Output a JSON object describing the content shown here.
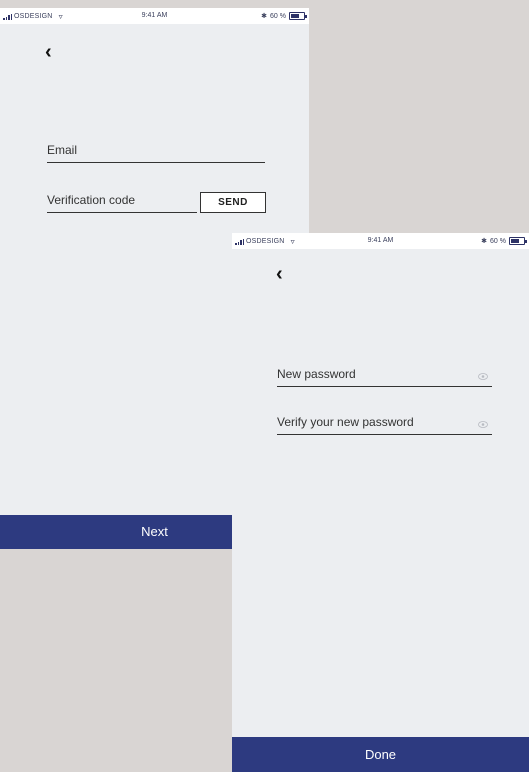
{
  "status_bar": {
    "carrier": "OSDESIGN",
    "time": "9:41 AM",
    "battery": "60 %"
  },
  "screen1": {
    "back_icon": "chevron-left-icon",
    "email_label": "Email",
    "code_label": "Verification code",
    "send_label": "SEND",
    "next_label": "Next"
  },
  "screen2": {
    "back_icon": "chevron-left-icon",
    "new_password_label": "New password",
    "verify_password_label": "Verify your new password",
    "eye_icon": "eye-icon",
    "done_label": "Done"
  },
  "colors": {
    "background": "#d9d5d3",
    "screen": "#eceef1",
    "primary": "#2d3a80"
  }
}
